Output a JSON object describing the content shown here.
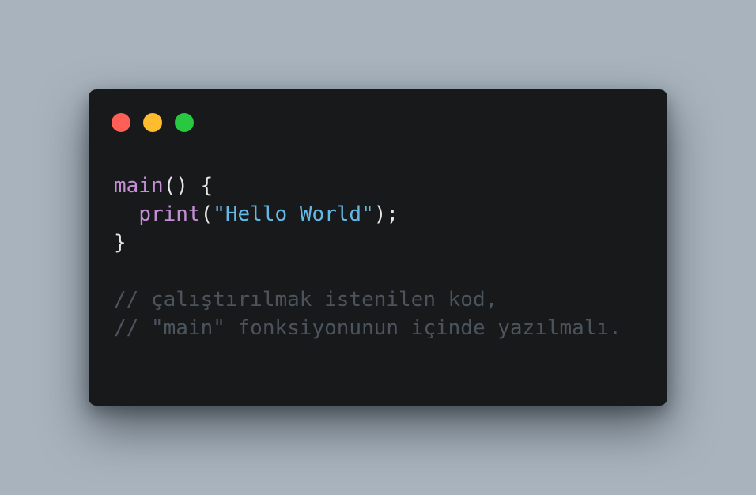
{
  "colors": {
    "background": "#a8b3bd",
    "window": "#18191b",
    "close": "#fe5f57",
    "minimize": "#febc2e",
    "zoom": "#28c840",
    "keyword": "#c58fd6",
    "string": "#63b9e6",
    "punctuation": "#e6e6e6",
    "comment": "#4b545c"
  },
  "window_controls": [
    "close-dot",
    "minimize-dot",
    "zoom-dot"
  ],
  "code": {
    "line1": {
      "func": "main",
      "rest": "() {"
    },
    "line2": {
      "indent": "  ",
      "func": "print",
      "open": "(",
      "string": "\"Hello World\"",
      "close": ");"
    },
    "line3": {
      "text": "}"
    },
    "line5": {
      "text": "// çalıştırılmak istenilen kod,"
    },
    "line6": {
      "text": "// \"main\" fonksiyonunun içinde yazılmalı."
    }
  }
}
